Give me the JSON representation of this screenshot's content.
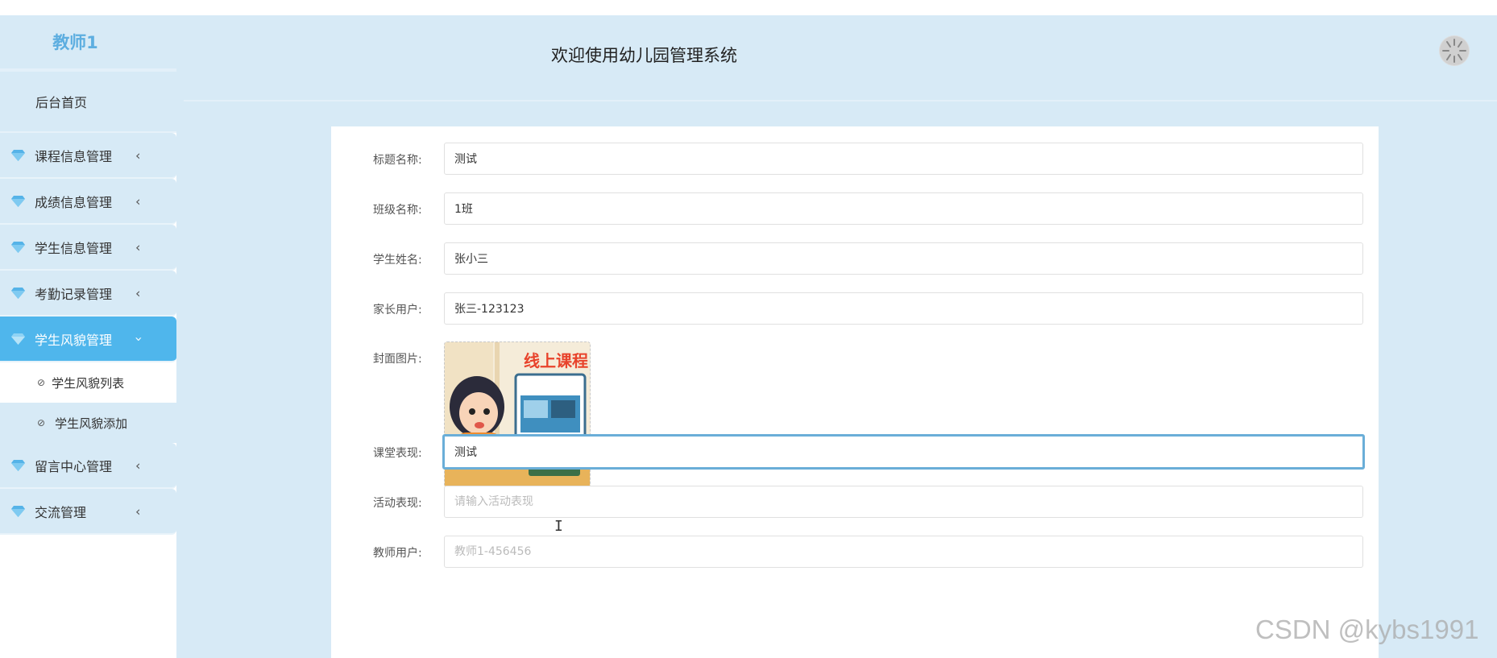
{
  "sidebar": {
    "brand": "教师1",
    "home": "后台首页",
    "menu": [
      {
        "label": "课程信息管理",
        "icon": "gem-icon",
        "active": false
      },
      {
        "label": "成绩信息管理",
        "icon": "gem-icon",
        "active": false
      },
      {
        "label": "学生信息管理",
        "icon": "gem-icon",
        "active": false
      },
      {
        "label": "考勤记录管理",
        "icon": "gem-icon",
        "active": false
      },
      {
        "label": "学生风貌管理",
        "icon": "gem-icon",
        "active": true
      },
      {
        "label": "留言中心管理",
        "icon": "gem-icon",
        "active": false
      },
      {
        "label": "交流管理",
        "icon": "gem-icon",
        "active": false
      }
    ],
    "submenu": [
      {
        "label": "学生风貌列表",
        "icon": "check-circle-icon"
      },
      {
        "label": "学生风貌添加",
        "icon": "check-circle-icon"
      }
    ]
  },
  "header": {
    "title": "欢迎使用幼儿园管理系统"
  },
  "form": {
    "title_label": "标题名称:",
    "title_value": "测试",
    "class_label": "班级名称:",
    "class_value": "1班",
    "student_label": "学生姓名:",
    "student_value": "张小三",
    "parent_label": "家长用户:",
    "parent_value": "张三-123123",
    "cover_label": "封面图片:",
    "cover_image_text": "线上课程",
    "classroom_label": "课堂表现:",
    "classroom_value": "测试",
    "activity_label": "活动表现:",
    "activity_placeholder": "请输入活动表现",
    "teacher_label": "教师用户:",
    "teacher_placeholder": "教师1-456456"
  },
  "watermark": "CSDN @kybs1991",
  "colors": {
    "background": "#d7eaf6",
    "active_menu": "#4fb6ec",
    "brand": "#5daee0",
    "focus_border": "#6aaed8"
  }
}
